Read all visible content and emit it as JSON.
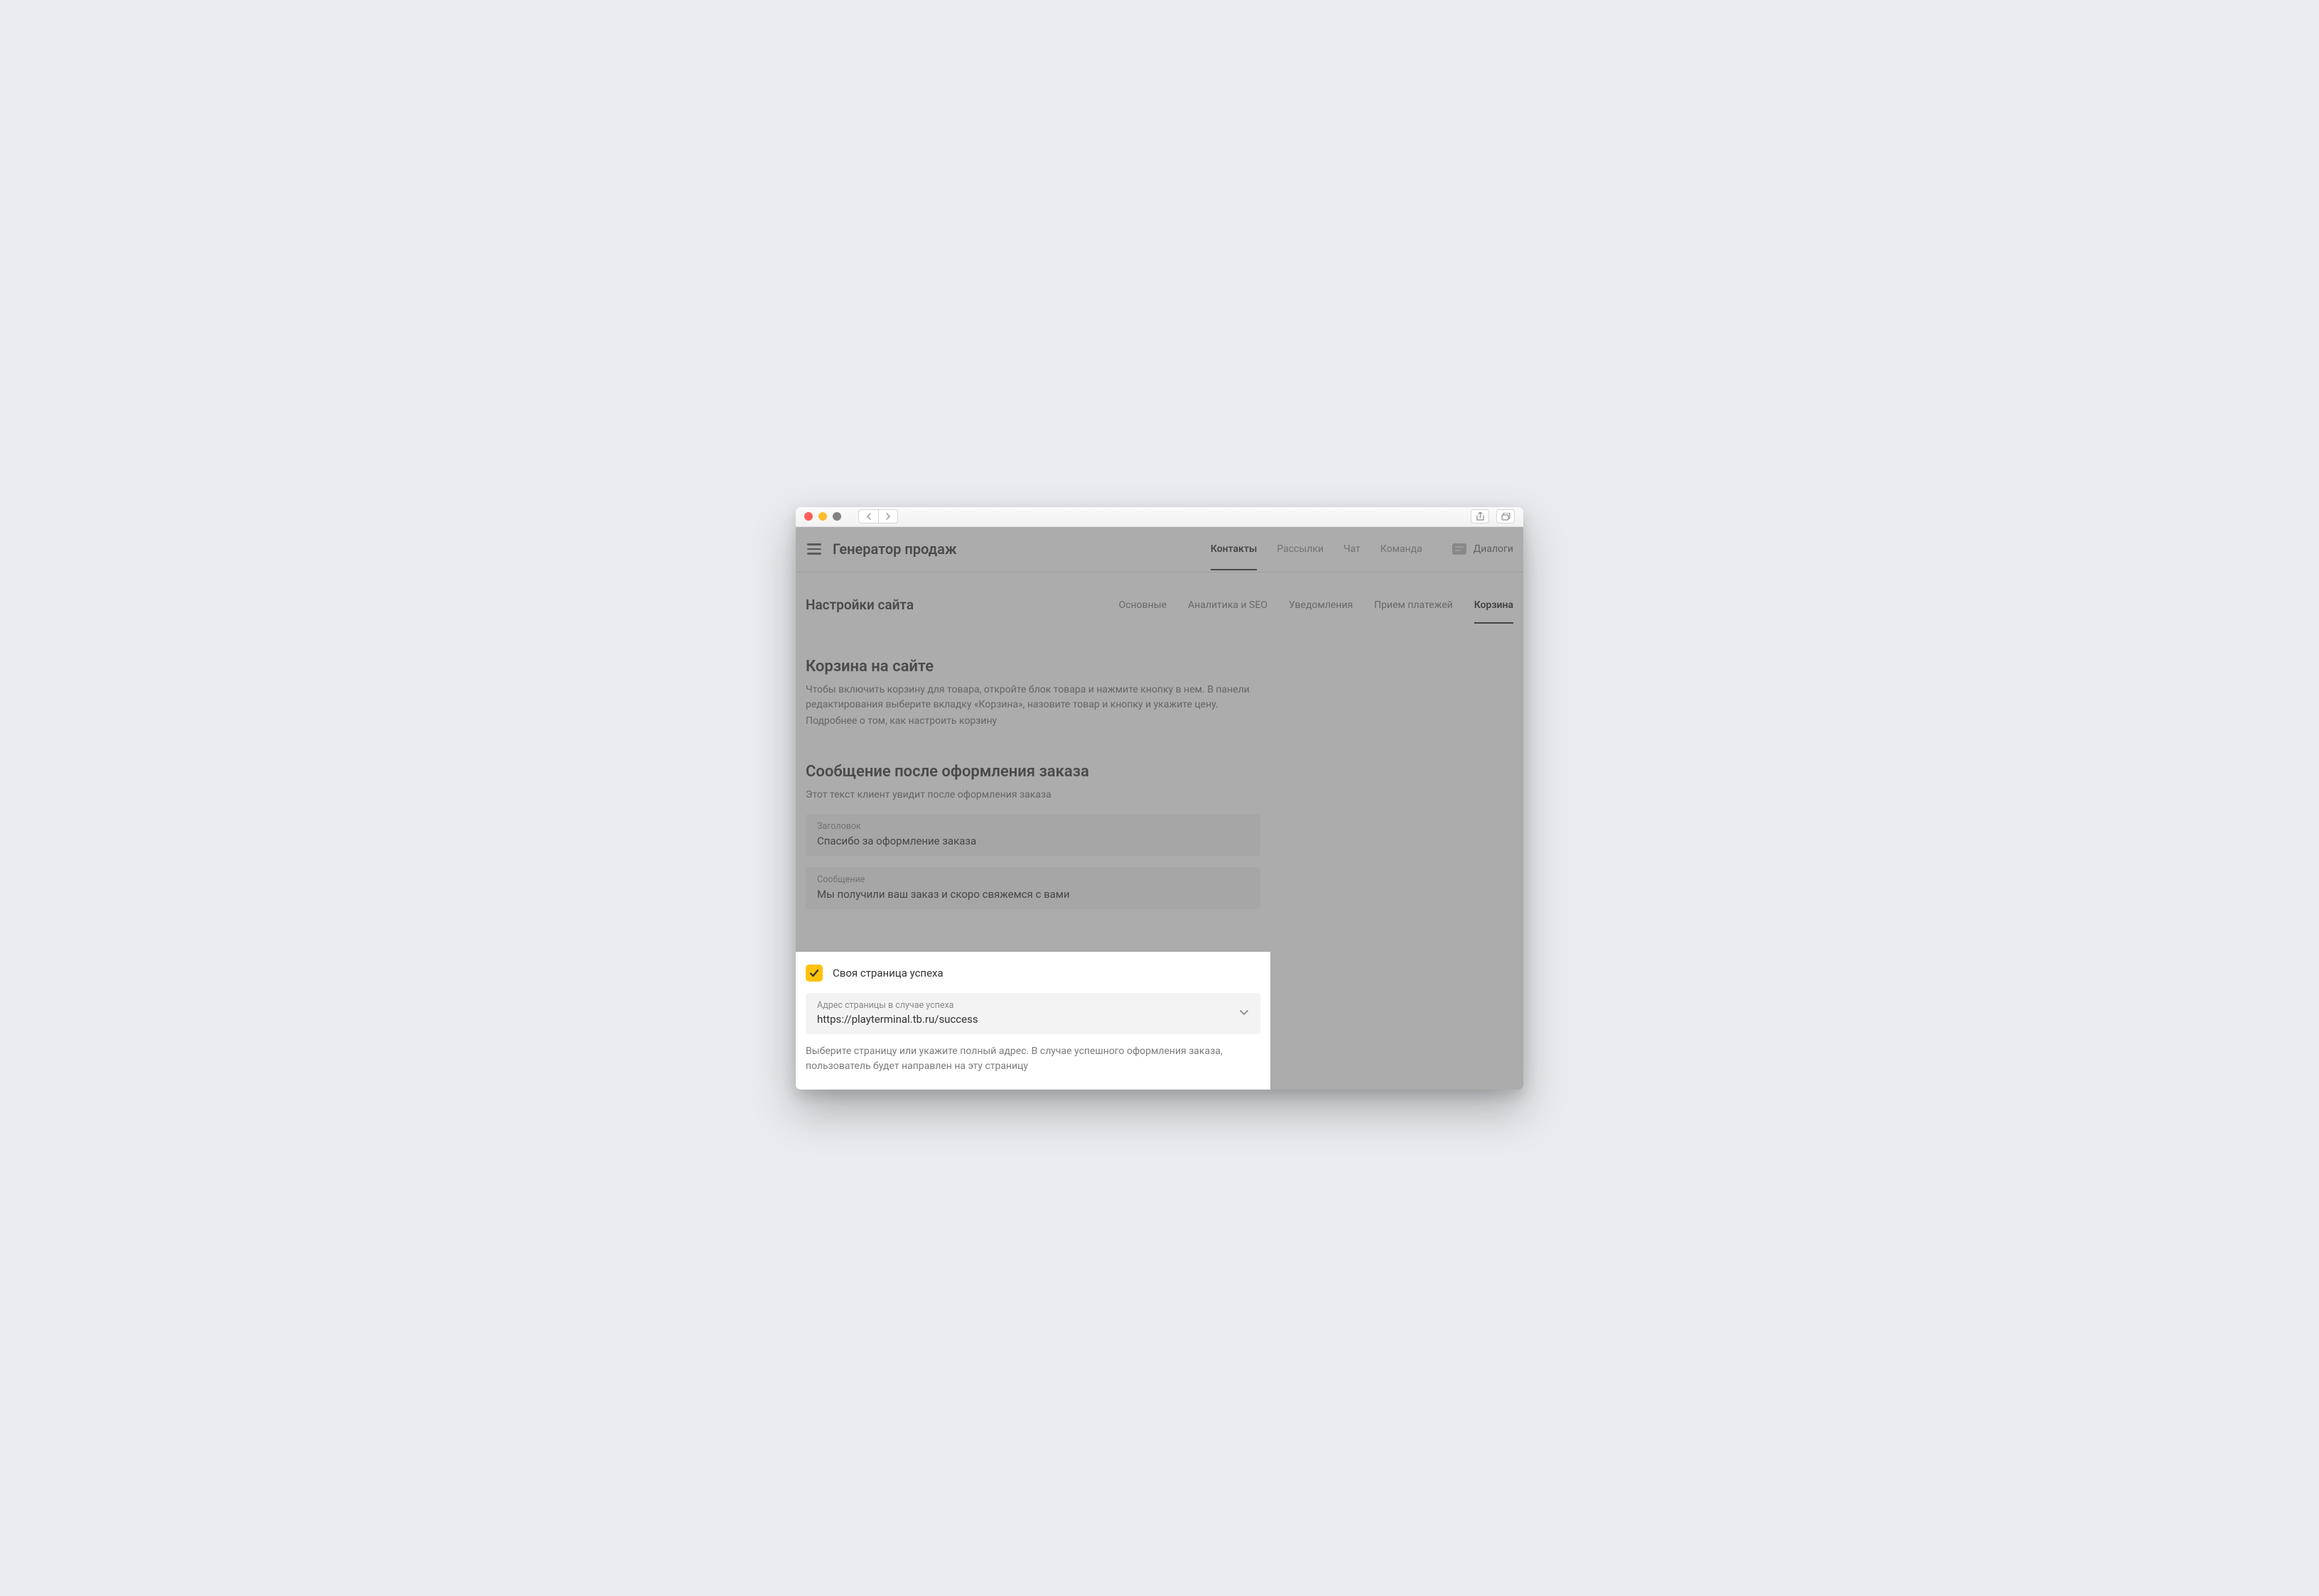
{
  "titlebar": {},
  "header": {
    "app_title": "Генератор продаж",
    "nav": [
      {
        "label": "Контакты",
        "active": true
      },
      {
        "label": "Рассылки",
        "active": false
      },
      {
        "label": "Чат",
        "active": false
      },
      {
        "label": "Команда",
        "active": false
      }
    ],
    "dialogs_label": "Диалоги"
  },
  "settings": {
    "title": "Настройки сайта",
    "tabs": [
      {
        "label": "Основные",
        "active": false
      },
      {
        "label": "Аналитика и SEO",
        "active": false
      },
      {
        "label": "Уведомления",
        "active": false
      },
      {
        "label": "Прием платежей",
        "active": false
      },
      {
        "label": "Корзина",
        "active": true
      }
    ]
  },
  "cart_section": {
    "title": "Корзина на сайте",
    "description": "Чтобы включить корзину для товара, откройте блок товара и нажмите кнопку в нем. В панели редактирования выберите вкладку «Корзина», назовите товар и кнопку и укажите цену.",
    "link_text": "Подробнее о том, как настроить корзину"
  },
  "message_section": {
    "title": "Сообщение после оформления заказа",
    "subtitle": "Этот текст клиент увидит после оформления заказа",
    "title_field": {
      "label": "Заголовок",
      "value": "Спасибо за оформление заказа"
    },
    "message_field": {
      "label": "Сообщение",
      "value": "Мы получили ваш заказ и скоро свяжемся с вами"
    }
  },
  "success_page": {
    "checkbox_checked": true,
    "label": "Своя страница успеха",
    "url_field": {
      "label": "Адрес страницы в случае успеха",
      "value": "https://playterminal.tb.ru/success"
    },
    "help_text": "Выберите страницу или укажите полный адрес. В случае успешного оформления заказа, пользователь будет направлен на эту страницу"
  }
}
